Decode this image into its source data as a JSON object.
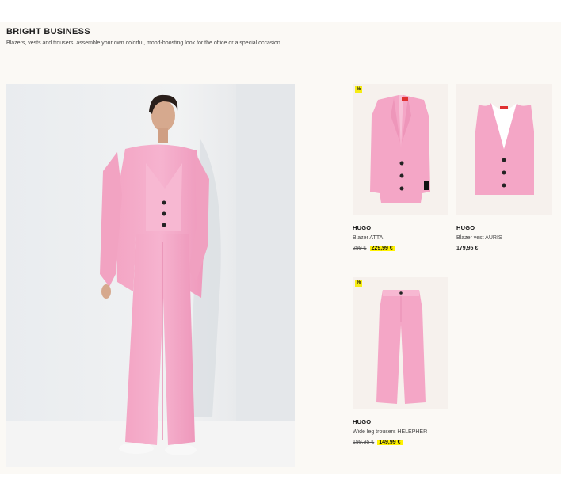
{
  "section": {
    "title": "BRIGHT BUSINESS",
    "subtitle": "Blazers, vests and trousers: assemble your own colorful, mood-boosting look for the office or a special occasion."
  },
  "products": [
    {
      "badge": "%",
      "brand": "HUGO",
      "name": "Blazer ATTA",
      "old_price": "299 €",
      "price": "229,99 €"
    },
    {
      "brand": "HUGO",
      "name": "Blazer vest AURIS",
      "price": "179,95 €"
    },
    {
      "badge": "%",
      "brand": "HUGO",
      "name": "Wide leg trousers HELEPHER",
      "old_price": "199,95 €",
      "price": "149,99 €"
    }
  ],
  "colors": {
    "accent_pink": "#f4a6c6",
    "sale_highlight": "#fff200"
  }
}
